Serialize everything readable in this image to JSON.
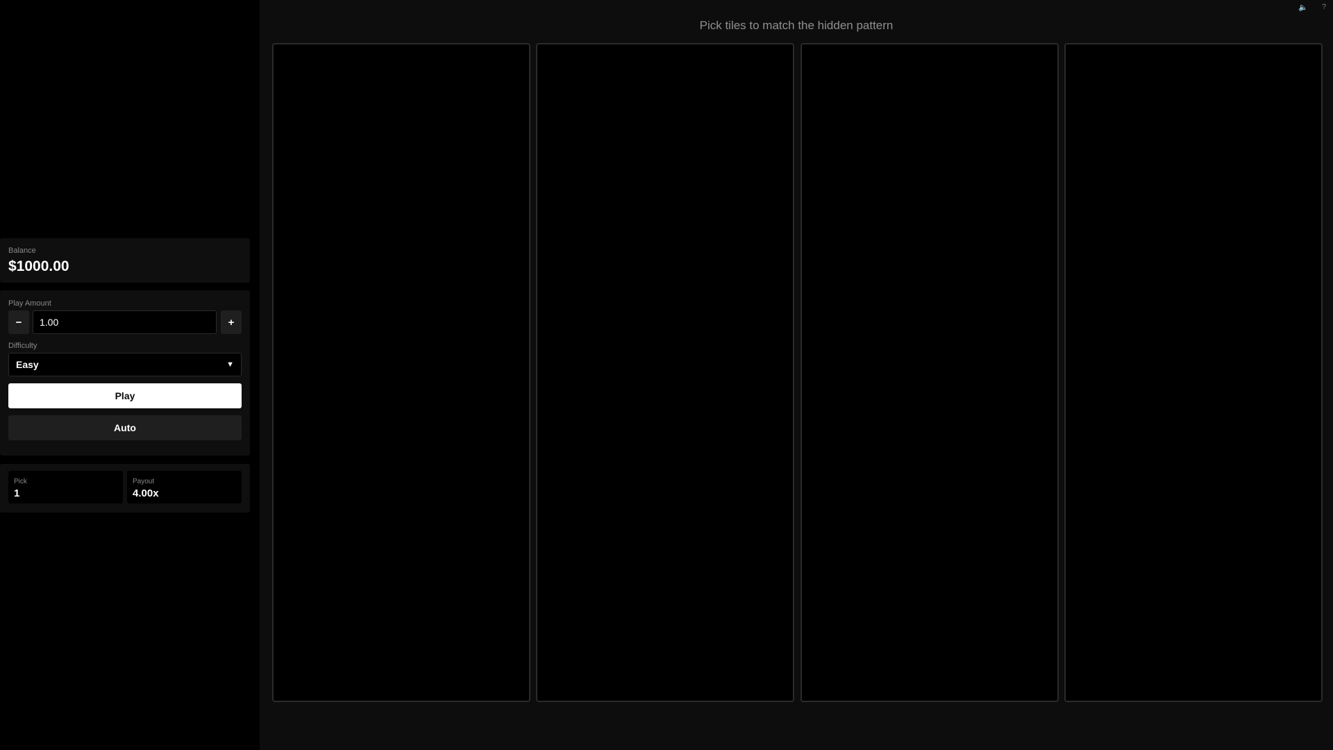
{
  "header": {
    "instruction": "Pick tiles to match the hidden pattern",
    "sound_icon": "🔈",
    "help_icon": "?"
  },
  "sidebar": {
    "balance": {
      "label": "Balance",
      "value": "$1000.00"
    },
    "play_amount": {
      "label": "Play Amount",
      "decrement": "−",
      "value": "1.00",
      "increment": "+"
    },
    "difficulty": {
      "label": "Difficulty",
      "selected": "Easy",
      "caret": "▼"
    },
    "play_button": "Play",
    "auto_button": "Auto",
    "stats": {
      "pick_label": "Pick",
      "pick_value": "1",
      "payout_label": "Payout",
      "payout_value": "4.00x"
    }
  },
  "board": {
    "columns": 4
  }
}
